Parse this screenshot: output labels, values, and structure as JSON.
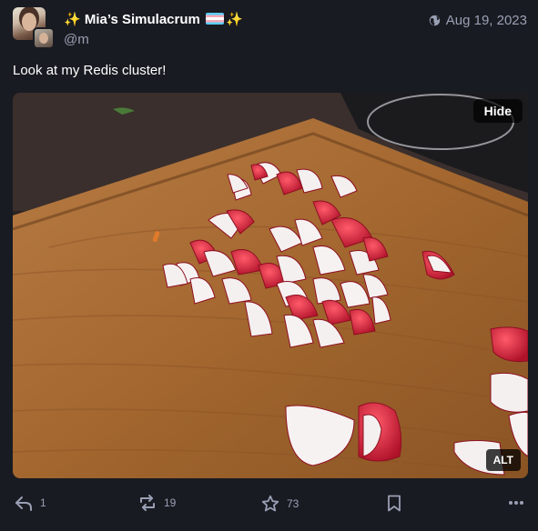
{
  "author": {
    "display_name": "Mia’s Simulacrum",
    "sparkle_left": "✨",
    "sparkle_right": "✨",
    "handle": "@m",
    "avatar_icon": "user-avatar-photo",
    "flag_icon": "transgender-flag-emoji"
  },
  "post": {
    "date": "Aug 19, 2023",
    "visibility_icon": "globe-icon",
    "text": "Look at my Redis cluster!",
    "media": {
      "description": "chopped radishes on wooden cutting board",
      "hide_label": "Hide",
      "alt_label": "ALT"
    }
  },
  "actions": {
    "reply_count": "1",
    "boost_count": "19",
    "favourite_count": "73",
    "icons": [
      "reply-icon",
      "boost-icon",
      "star-icon",
      "bookmark-icon",
      "more-icon"
    ]
  },
  "colors": {
    "background": "#191b22",
    "text": "#ffffff",
    "muted": "#9aa0b4"
  }
}
